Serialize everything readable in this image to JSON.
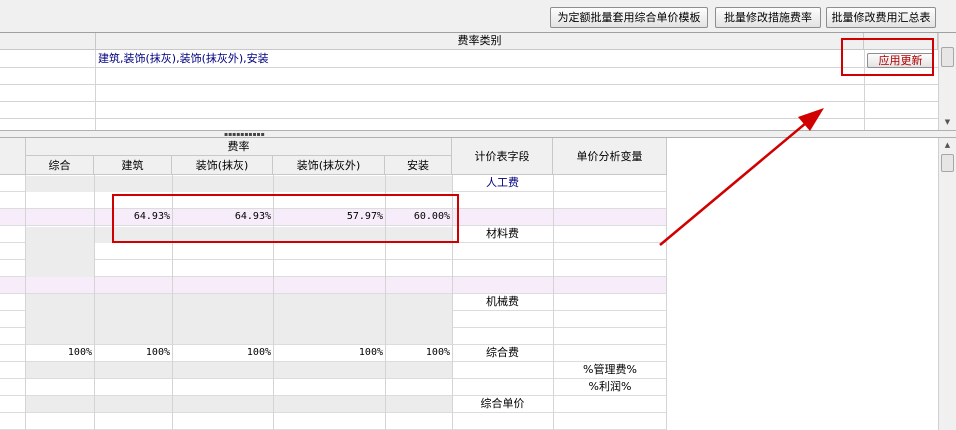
{
  "toolbar": {
    "btn_apply_template": "为定额批量套用综合单价模板",
    "btn_modify_measure": "批量修改措施费率",
    "btn_modify_summary": "批量修改费用汇总表"
  },
  "upper_grid": {
    "header": "费率类别",
    "row1_value": "建筑,装饰(抹灰),装饰(抹灰外),安装",
    "apply_button": "应用更新"
  },
  "lower_grid": {
    "header_group": "费率",
    "columns": [
      "综合",
      "建筑",
      "装饰(抹灰)",
      "装饰(抹灰外)",
      "安装"
    ],
    "field_header": "计价表字段",
    "var_header": "单价分析变量",
    "labor_label": "人工费",
    "material_label": "材料费",
    "machine_label": "机械费",
    "combined_label": "综合费",
    "unit_price_label": "综合单价",
    "mgmt_var": "%管理费%",
    "profit_var": "%利润%",
    "rate_row": [
      "",
      "64.93%",
      "64.93%",
      "57.97%",
      "60.00%"
    ],
    "combined_row": [
      "100%",
      "100%",
      "100%",
      "100%",
      "100%"
    ]
  },
  "colors": {
    "highlight_red": "#d10000",
    "pink_row": "#f7ecfa",
    "label_blue": "#000080"
  }
}
